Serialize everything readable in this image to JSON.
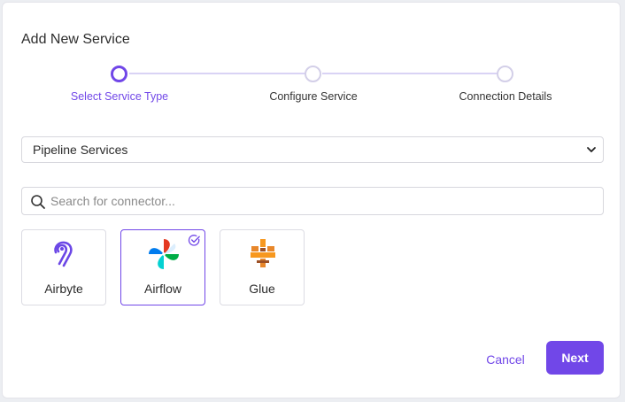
{
  "dialog": {
    "title": "Add New Service"
  },
  "stepper": {
    "steps": [
      {
        "label": "Select Service Type",
        "active": true
      },
      {
        "label": "Configure Service",
        "active": false
      },
      {
        "label": "Connection Details",
        "active": false
      }
    ]
  },
  "service_type_select": {
    "value": "Pipeline Services",
    "icon": "chevron-down-icon"
  },
  "search": {
    "placeholder": "Search for connector...",
    "value": "",
    "icon": "search-icon"
  },
  "connectors": [
    {
      "name": "Airbyte",
      "icon": "airbyte-logo",
      "selected": false
    },
    {
      "name": "Airflow",
      "icon": "airflow-logo",
      "selected": true
    },
    {
      "name": "Glue",
      "icon": "glue-logo",
      "selected": false
    }
  ],
  "actions": {
    "cancel_label": "Cancel",
    "next_label": "Next"
  },
  "colors": {
    "accent": "#7147e8",
    "border": "#dcdce3",
    "step_inactive": "#d3cfe8"
  }
}
